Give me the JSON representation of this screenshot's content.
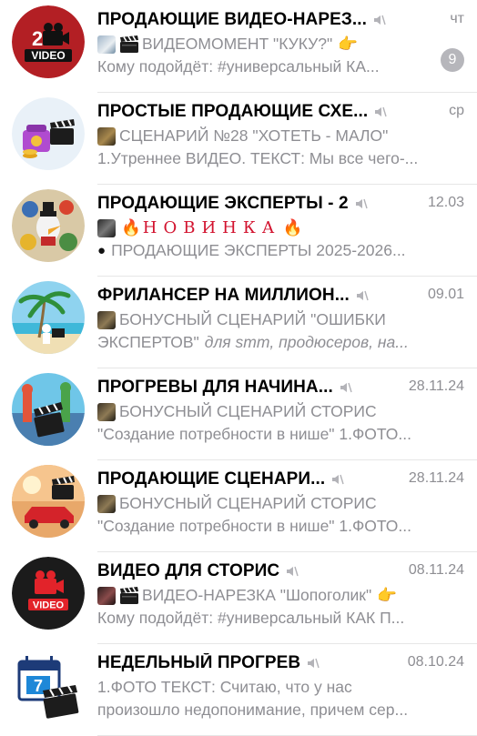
{
  "chats": [
    {
      "title": "ПРОДАЮЩИЕ ВИДЕО-НАРЕЗ...",
      "date": "чт",
      "line2": "ВИДЕОМОМЕНТ \"КУКУ?\"",
      "line3": "Кому подойдёт: #универсальный  КА...",
      "badge": "9",
      "avatar_text": "VIDEO",
      "avatar_num": "2"
    },
    {
      "title": "ПРОСТЫЕ ПРОДАЮЩИЕ СХЕ...",
      "date": "ср",
      "line2": "СЦЕНАРИЙ №28 \"ХОТЕТЬ - МАЛО\"",
      "line3": "1.Утреннее ВИДЕО. ТЕКСТ: Мы все чего-..."
    },
    {
      "title": "ПРОДАЮЩИЕ ЭКСПЕРТЫ - 2",
      "date": "12.03",
      "line2": "НОВИНКА",
      "line3": "ПРОДАЮЩИЕ ЭКСПЕРТЫ 2025-2026..."
    },
    {
      "title": "ФРИЛАНСЕР НА МИЛЛИОН...",
      "date": "09.01",
      "line2": "БОНУСНЫЙ СЦЕНАРИЙ \"ОШИБКИ",
      "line3a": "ЭКСПЕРТОВ\"",
      "line3b": "для smm, продюсеров, на..."
    },
    {
      "title": "ПРОГРЕВЫ ДЛЯ НАЧИНА...",
      "date": "28.11.24",
      "line2": "БОНУСНЫЙ СЦЕНАРИЙ СТОРИС",
      "line3": "\"Создание потребности в нише\" 1.ФОТО..."
    },
    {
      "title": "ПРОДАЮЩИЕ СЦЕНАРИ...",
      "date": "28.11.24",
      "line2": "БОНУСНЫЙ СЦЕНАРИЙ СТОРИС",
      "line3": "\"Создание потребности в нише\" 1.ФОТО..."
    },
    {
      "title": "ВИДЕО ДЛЯ СТОРИС",
      "date": "08.11.24",
      "line2": "ВИДЕО-НАРЕЗКА \"Шопоголик\"",
      "line3": "Кому подойдёт: #универсальный  КАК П...",
      "avatar_text": "VIDEO"
    },
    {
      "title": "НЕДЕЛЬНЫЙ ПРОГРЕВ",
      "date": "08.10.24",
      "line2": "1.ФОТО ТЕКСТ: Считаю, что у нас",
      "line3": "произошло недопонимание, причем сер...",
      "avatar_num": "7"
    }
  ],
  "colors": {
    "muted": "#8e8e93",
    "badge": "#b6b6bb",
    "accent_red": "#d2122e"
  }
}
